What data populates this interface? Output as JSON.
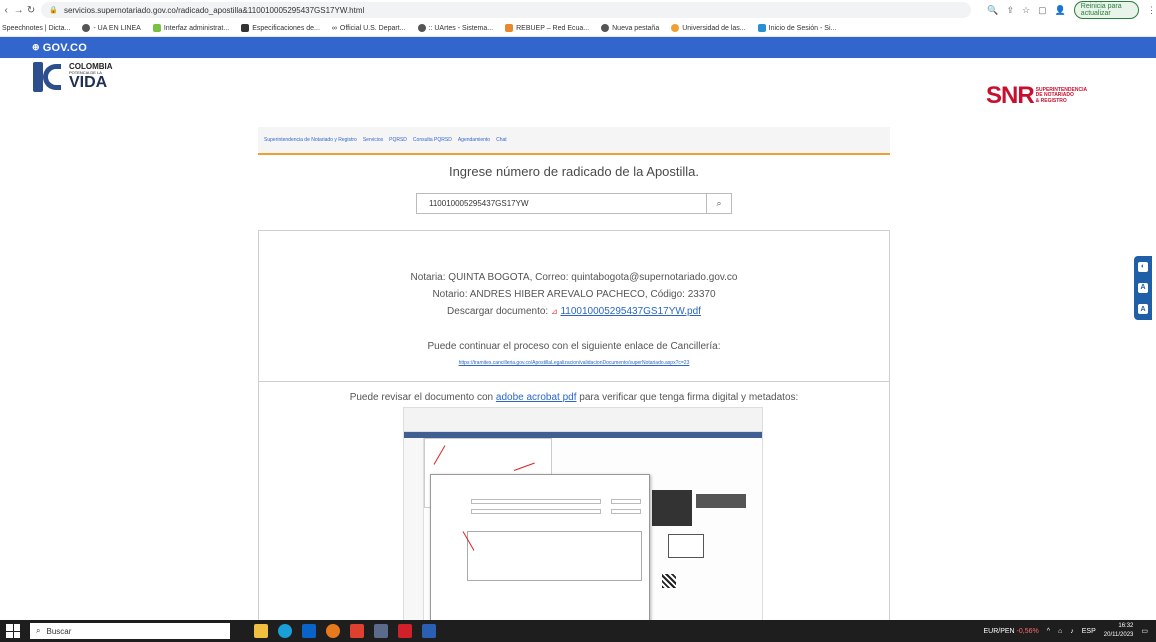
{
  "browser": {
    "url": "servicios.supernotariado.gov.co/radicado_apostilla&110010005295437GS17YW.html",
    "update_label": "Reinicia para actualizar",
    "bookmarks": [
      "Speechnotes | Dicta...",
      "- UA EN LINEA",
      "Interfaz administrat...",
      "Especificaciones de...",
      "Official U.S. Depart...",
      ":: UArtes - Sistema...",
      "REBUEP – Red Ecua...",
      "Nueva pestaña",
      "Universidad de las...",
      "Inicio de Sesión - Si..."
    ]
  },
  "govbar": {
    "label": "GOV.CO"
  },
  "header": {
    "colombia": {
      "line1": "COLOMBIA",
      "line2": "POTENCIA DE LA",
      "line3": "VIDA"
    },
    "snr": {
      "big": "SNR",
      "small1": "SUPERINTENDENCIA",
      "small2": "DE NOTARIADO",
      "small3": "& REGISTRO"
    }
  },
  "menu": {
    "items": [
      "Superintendencia de Notariado y Registro",
      "Servicios",
      "PQRSD",
      "Consulta PQRSD",
      "Agendamiento",
      "Chat"
    ]
  },
  "page": {
    "heading": "Ingrese número de radicado de la Apostilla.",
    "search_value": "110010005295437GS17YW"
  },
  "result": {
    "line1": "Notaria: QUINTA BOGOTA, Correo: quintabogota@supernotariado.gov.co",
    "line2": "Notario: ANDRES HIBER AREVALO PACHECO, Código: 23370",
    "download_prefix": "Descargar documento:",
    "download_file": "110010005295437GS17YW.pdf",
    "cancilleria_text": "Puede continuar el proceso con el siguiente enlace de Cancillería:",
    "cancilleria_link": "https://tramites.cancilleria.gov.co/ApostillaLegalizacion/validacionDocumento/superNotariado.aspx?c=23",
    "review_prefix": "Puede revisar el documento con",
    "review_link": "adobe acrobat pdf",
    "review_suffix": "para verificar que tenga firma digital y metadatos:"
  },
  "taskbar": {
    "search_label": "Buscar",
    "currency": "EUR/PEN",
    "currency_change": "-0,56%",
    "lang": "ESP",
    "time": "16:32",
    "date": "20/11/2023"
  }
}
